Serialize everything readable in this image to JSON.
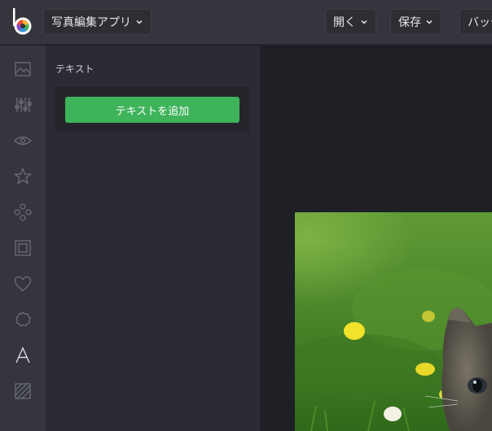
{
  "header": {
    "app_menu_label": "写真編集アプリ",
    "open_label": "開く",
    "save_label": "保存",
    "batch_label": "バッチ"
  },
  "sidebar": {
    "tools": [
      {
        "icon": "image-icon"
      },
      {
        "icon": "sliders-icon"
      },
      {
        "icon": "eye-icon"
      },
      {
        "icon": "star-icon"
      },
      {
        "icon": "shapes-icon"
      },
      {
        "icon": "frame-icon"
      },
      {
        "icon": "heart-icon"
      },
      {
        "icon": "badge-icon"
      },
      {
        "icon": "text-icon"
      },
      {
        "icon": "texture-icon"
      }
    ]
  },
  "panel": {
    "title": "テキスト",
    "add_text_button": "テキストを追加"
  },
  "colors": {
    "topbar": "#35363d",
    "panel": "#2b2c33",
    "canvas": "#1f2025",
    "accent_green": "#3eb35a"
  }
}
